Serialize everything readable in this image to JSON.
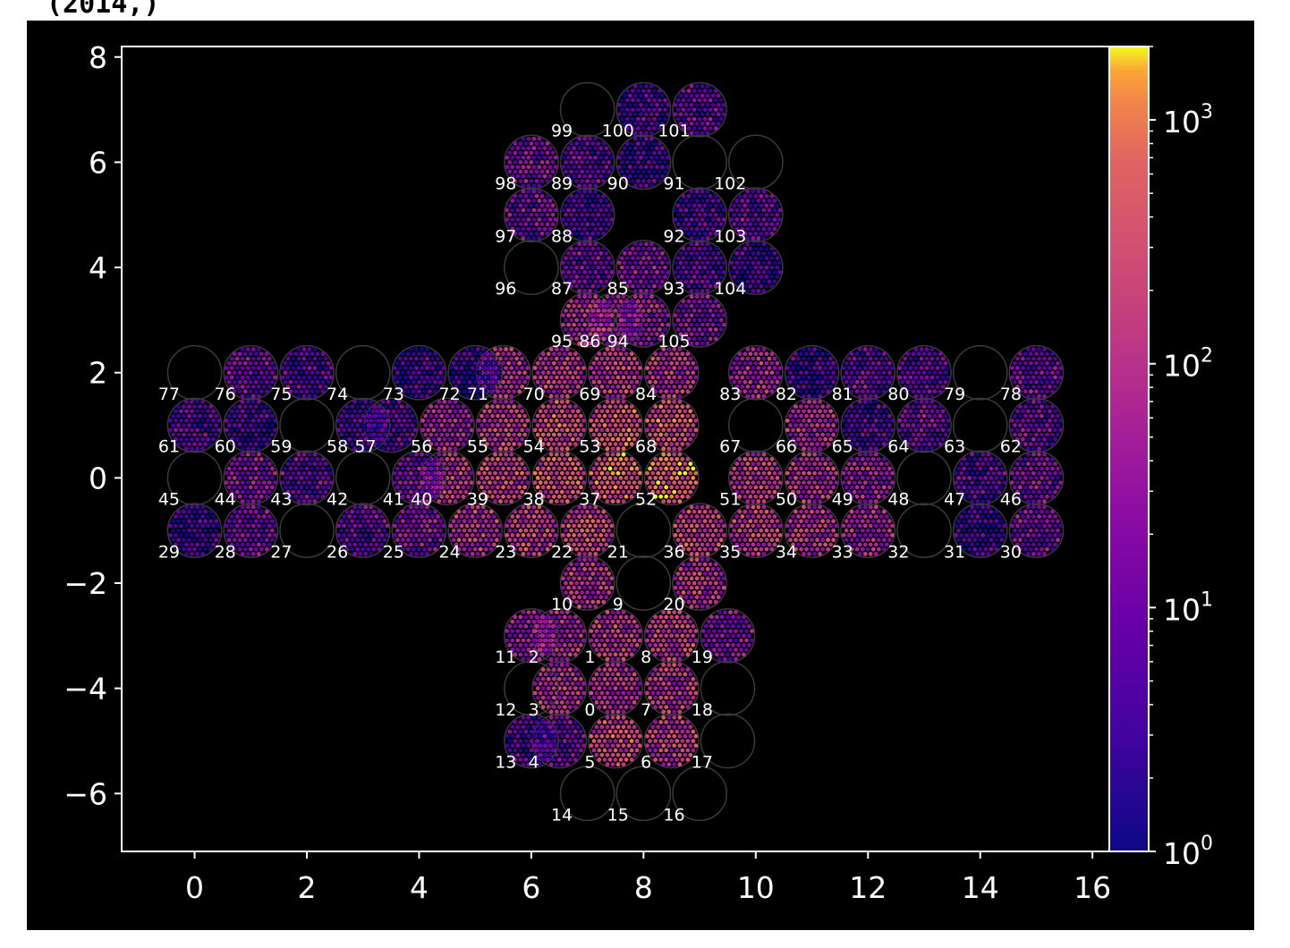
{
  "output_text": "(2014,)",
  "chart_data": {
    "type": "scatter",
    "title": "",
    "xlabel": "",
    "ylabel": "",
    "xlim": [
      -1.3,
      16.3
    ],
    "ylim": [
      -7.1,
      8.2
    ],
    "x_ticks": [
      "0",
      "2",
      "4",
      "6",
      "8",
      "10",
      "12",
      "14",
      "16"
    ],
    "x_tick_values": [
      0,
      2,
      4,
      6,
      8,
      10,
      12,
      14,
      16
    ],
    "y_ticks": [
      "8",
      "6",
      "4",
      "2",
      "0",
      "−2",
      "−4",
      "−6"
    ],
    "y_tick_values": [
      8,
      6,
      4,
      2,
      0,
      -2,
      -4,
      -6
    ],
    "colorbar": {
      "scale": "log",
      "colormap": "plasma",
      "range": [
        1,
        2000
      ],
      "tick_values": [
        1,
        10,
        100,
        1000
      ],
      "tick_bases": [
        "10",
        "10",
        "10",
        "10"
      ],
      "tick_exponents": [
        "0",
        "1",
        "2",
        "3"
      ]
    },
    "circles": [
      {
        "id": "0",
        "x": 7.5,
        "y": -4.0,
        "level": 0.62
      },
      {
        "id": "1",
        "x": 7.5,
        "y": -3.0,
        "level": 0.65
      },
      {
        "id": "2",
        "x": 6.5,
        "y": -3.0,
        "level": 0.58
      },
      {
        "id": "3",
        "x": 6.5,
        "y": -4.0,
        "level": 0.6
      },
      {
        "id": "4",
        "x": 6.5,
        "y": -5.0,
        "level": 0.35
      },
      {
        "id": "5",
        "x": 7.5,
        "y": -5.0,
        "level": 0.75
      },
      {
        "id": "6",
        "x": 8.5,
        "y": -5.0,
        "level": 0.68
      },
      {
        "id": "7",
        "x": 8.5,
        "y": -4.0,
        "level": 0.64
      },
      {
        "id": "8",
        "x": 8.5,
        "y": -3.0,
        "level": 0.66
      },
      {
        "id": "9",
        "x": 8.0,
        "y": -2.0,
        "level": -1
      },
      {
        "id": "10",
        "x": 7.0,
        "y": -2.0,
        "level": 0.62
      },
      {
        "id": "11",
        "x": 6.0,
        "y": -3.0,
        "level": 0.52
      },
      {
        "id": "12",
        "x": 6.0,
        "y": -4.0,
        "level": -1
      },
      {
        "id": "13",
        "x": 6.0,
        "y": -5.0,
        "level": 0.28
      },
      {
        "id": "14",
        "x": 7.0,
        "y": -6.0,
        "level": -1
      },
      {
        "id": "15",
        "x": 8.0,
        "y": -6.0,
        "level": -1
      },
      {
        "id": "16",
        "x": 9.0,
        "y": -6.0,
        "level": -1
      },
      {
        "id": "17",
        "x": 9.5,
        "y": -5.0,
        "level": -1
      },
      {
        "id": "18",
        "x": 9.5,
        "y": -4.0,
        "level": -1
      },
      {
        "id": "19",
        "x": 9.5,
        "y": -3.0,
        "level": 0.45
      },
      {
        "id": "20",
        "x": 9.0,
        "y": -2.0,
        "level": 0.62
      },
      {
        "id": "21",
        "x": 8.0,
        "y": -1.0,
        "level": -1
      },
      {
        "id": "22",
        "x": 7.0,
        "y": -1.0,
        "level": 0.72
      },
      {
        "id": "23",
        "x": 6.0,
        "y": -1.0,
        "level": 0.68
      },
      {
        "id": "24",
        "x": 5.0,
        "y": -1.0,
        "level": 0.62
      },
      {
        "id": "25",
        "x": 4.0,
        "y": -1.0,
        "level": 0.45
      },
      {
        "id": "26",
        "x": 3.0,
        "y": -1.0,
        "level": 0.35
      },
      {
        "id": "27",
        "x": 2.0,
        "y": -1.0,
        "level": -1
      },
      {
        "id": "28",
        "x": 1.0,
        "y": -1.0,
        "level": 0.38
      },
      {
        "id": "29",
        "x": 0.0,
        "y": -1.0,
        "level": 0.2
      },
      {
        "id": "30",
        "x": 15.0,
        "y": -1.0,
        "level": 0.4
      },
      {
        "id": "31",
        "x": 14.0,
        "y": -1.0,
        "level": 0.22
      },
      {
        "id": "32",
        "x": 13.0,
        "y": -1.0,
        "level": -1
      },
      {
        "id": "33",
        "x": 12.0,
        "y": -1.0,
        "level": 0.55
      },
      {
        "id": "34",
        "x": 11.0,
        "y": -1.0,
        "level": 0.62
      },
      {
        "id": "35",
        "x": 10.0,
        "y": -1.0,
        "level": 0.7
      },
      {
        "id": "36",
        "x": 9.0,
        "y": -1.0,
        "level": 0.72
      },
      {
        "id": "37",
        "x": 7.5,
        "y": 0.0,
        "level": 0.85
      },
      {
        "id": "38",
        "x": 6.5,
        "y": 0.0,
        "level": 0.8
      },
      {
        "id": "39",
        "x": 5.5,
        "y": 0.0,
        "level": 0.72
      },
      {
        "id": "40",
        "x": 4.5,
        "y": 0.0,
        "level": 0.65
      },
      {
        "id": "41",
        "x": 4.0,
        "y": 0.0,
        "level": 0.38
      },
      {
        "id": "42",
        "x": 3.0,
        "y": 0.0,
        "level": -1
      },
      {
        "id": "43",
        "x": 2.0,
        "y": 0.0,
        "level": 0.35
      },
      {
        "id": "44",
        "x": 1.0,
        "y": 0.0,
        "level": 0.45
      },
      {
        "id": "45",
        "x": 0.0,
        "y": 0.0,
        "level": -1
      },
      {
        "id": "46",
        "x": 15.0,
        "y": 0.0,
        "level": 0.4
      },
      {
        "id": "47",
        "x": 14.0,
        "y": 0.0,
        "level": 0.3
      },
      {
        "id": "48",
        "x": 13.0,
        "y": 0.0,
        "level": -1
      },
      {
        "id": "49",
        "x": 12.0,
        "y": 0.0,
        "level": 0.52
      },
      {
        "id": "50",
        "x": 11.0,
        "y": 0.0,
        "level": 0.62
      },
      {
        "id": "51",
        "x": 10.0,
        "y": 0.0,
        "level": 0.7
      },
      {
        "id": "52",
        "x": 8.5,
        "y": 0.0,
        "level": 0.88
      },
      {
        "id": "53",
        "x": 7.5,
        "y": 1.0,
        "level": 0.8
      },
      {
        "id": "54",
        "x": 6.5,
        "y": 1.0,
        "level": 0.75
      },
      {
        "id": "55",
        "x": 5.5,
        "y": 1.0,
        "level": 0.68
      },
      {
        "id": "56",
        "x": 4.5,
        "y": 1.0,
        "level": 0.55
      },
      {
        "id": "57",
        "x": 3.5,
        "y": 1.0,
        "level": 0.3
      },
      {
        "id": "58",
        "x": 3.0,
        "y": 1.0,
        "level": 0.22
      },
      {
        "id": "59",
        "x": 2.0,
        "y": 1.0,
        "level": -1
      },
      {
        "id": "60",
        "x": 1.0,
        "y": 1.0,
        "level": 0.25
      },
      {
        "id": "61",
        "x": 0.0,
        "y": 1.0,
        "level": 0.3
      },
      {
        "id": "62",
        "x": 15.0,
        "y": 1.0,
        "level": 0.35
      },
      {
        "id": "63",
        "x": 14.0,
        "y": 1.0,
        "level": -1
      },
      {
        "id": "64",
        "x": 13.0,
        "y": 1.0,
        "level": 0.38
      },
      {
        "id": "65",
        "x": 12.0,
        "y": 1.0,
        "level": 0.25
      },
      {
        "id": "66",
        "x": 11.0,
        "y": 1.0,
        "level": 0.62
      },
      {
        "id": "67",
        "x": 10.0,
        "y": 1.0,
        "level": -1
      },
      {
        "id": "68",
        "x": 8.5,
        "y": 1.0,
        "level": 0.78
      },
      {
        "id": "69",
        "x": 7.5,
        "y": 2.0,
        "level": 0.68
      },
      {
        "id": "70",
        "x": 6.5,
        "y": 2.0,
        "level": 0.65
      },
      {
        "id": "71",
        "x": 5.5,
        "y": 2.0,
        "level": 0.62
      },
      {
        "id": "72",
        "x": 5.0,
        "y": 2.0,
        "level": 0.18
      },
      {
        "id": "73",
        "x": 4.0,
        "y": 2.0,
        "level": 0.22
      },
      {
        "id": "74",
        "x": 3.0,
        "y": 2.0,
        "level": -1
      },
      {
        "id": "75",
        "x": 2.0,
        "y": 2.0,
        "level": 0.3
      },
      {
        "id": "76",
        "x": 1.0,
        "y": 2.0,
        "level": 0.35
      },
      {
        "id": "77",
        "x": 0.0,
        "y": 2.0,
        "level": -1
      },
      {
        "id": "78",
        "x": 15.0,
        "y": 2.0,
        "level": 0.38
      },
      {
        "id": "79",
        "x": 14.0,
        "y": 2.0,
        "level": -1
      },
      {
        "id": "80",
        "x": 13.0,
        "y": 2.0,
        "level": 0.3
      },
      {
        "id": "81",
        "x": 12.0,
        "y": 2.0,
        "level": 0.35
      },
      {
        "id": "82",
        "x": 11.0,
        "y": 2.0,
        "level": 0.22
      },
      {
        "id": "83",
        "x": 10.0,
        "y": 2.0,
        "level": 0.55
      },
      {
        "id": "84",
        "x": 8.5,
        "y": 2.0,
        "level": 0.65
      },
      {
        "id": "85",
        "x": 8.0,
        "y": 4.0,
        "level": 0.45
      },
      {
        "id": "86",
        "x": 7.5,
        "y": 3.0,
        "level": 0.5
      },
      {
        "id": "87",
        "x": 7.0,
        "y": 4.0,
        "level": 0.35
      },
      {
        "id": "88",
        "x": 7.0,
        "y": 5.0,
        "level": 0.25
      },
      {
        "id": "89",
        "x": 7.0,
        "y": 6.0,
        "level": 0.3
      },
      {
        "id": "90",
        "x": 8.0,
        "y": 6.0,
        "level": 0.22
      },
      {
        "id": "91",
        "x": 9.0,
        "y": 6.0,
        "level": -1
      },
      {
        "id": "92",
        "x": 9.0,
        "y": 5.0,
        "level": 0.25
      },
      {
        "id": "93",
        "x": 9.0,
        "y": 4.0,
        "level": 0.3
      },
      {
        "id": "94",
        "x": 8.0,
        "y": 3.0,
        "level": 0.48
      },
      {
        "id": "95",
        "x": 7.0,
        "y": 3.0,
        "level": 0.6
      },
      {
        "id": "96",
        "x": 6.0,
        "y": 4.0,
        "level": -1
      },
      {
        "id": "97",
        "x": 6.0,
        "y": 5.0,
        "level": 0.38
      },
      {
        "id": "98",
        "x": 6.0,
        "y": 6.0,
        "level": 0.4
      },
      {
        "id": "99",
        "x": 7.0,
        "y": 7.0,
        "level": -1
      },
      {
        "id": "100",
        "x": 8.0,
        "y": 7.0,
        "level": 0.25
      },
      {
        "id": "101",
        "x": 9.0,
        "y": 7.0,
        "level": 0.35
      },
      {
        "id": "102",
        "x": 10.0,
        "y": 6.0,
        "level": -1
      },
      {
        "id": "103",
        "x": 10.0,
        "y": 5.0,
        "level": 0.35
      },
      {
        "id": "104",
        "x": 10.0,
        "y": 4.0,
        "level": 0.22
      },
      {
        "id": "105",
        "x": 9.0,
        "y": 3.0,
        "level": 0.45
      }
    ]
  }
}
